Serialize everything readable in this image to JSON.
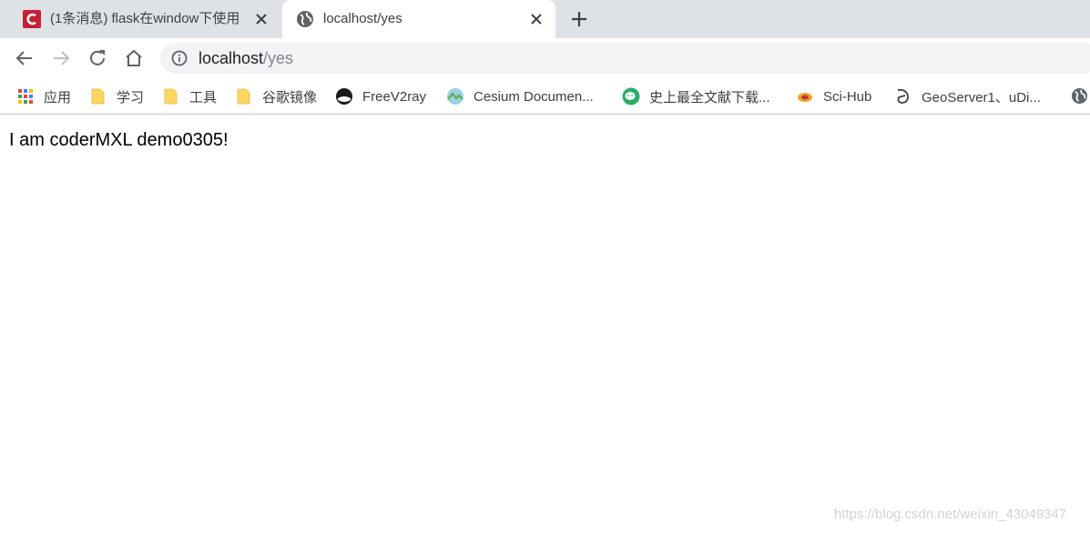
{
  "tabs": [
    {
      "title": "(1条消息) flask在window下使用",
      "active": false,
      "favicon": "csdn-logo-icon"
    },
    {
      "title": "localhost/yes",
      "active": true,
      "favicon": "globe-icon"
    }
  ],
  "address_bar": {
    "host": "localhost",
    "path": "/yes"
  },
  "bookmarks": [
    {
      "label": "应用",
      "icon": "apps-grid-icon"
    },
    {
      "label": "学习",
      "icon": "folder-icon"
    },
    {
      "label": "工具",
      "icon": "folder-icon"
    },
    {
      "label": "谷歌镜像",
      "icon": "folder-icon"
    },
    {
      "label": "FreeV2ray",
      "icon": "freev2ray-icon"
    },
    {
      "label": "Cesium Documen...",
      "icon": "cesium-icon"
    },
    {
      "label": "史上最全文献下载...",
      "icon": "wechat-icon"
    },
    {
      "label": "Sci-Hub",
      "icon": "scihub-icon"
    },
    {
      "label": "GeoServer1、uDi...",
      "icon": "geoserver-icon"
    }
  ],
  "page": {
    "text": "I am coderMXL demo0305!"
  },
  "watermark": "https://blog.csdn.net/weixin_43049347",
  "colors": {
    "tabstrip": "#dee1e6",
    "omnibox": "#f1f3f4",
    "csdn_red": "#c32136",
    "folder": "#fdd663"
  }
}
